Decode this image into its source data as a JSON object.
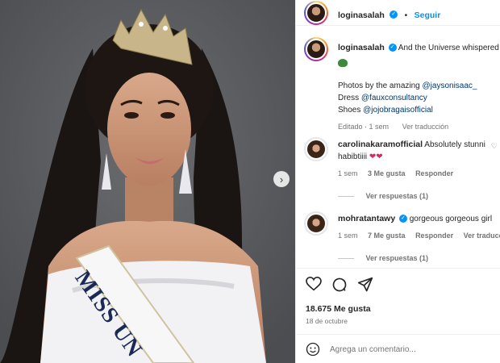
{
  "post": {
    "username": "loginasalah",
    "follow_label": "Seguir",
    "caption_preview": "And the Universe whispered",
    "credits_line": "Photos by the amazing",
    "photographer": "@jaysonisaac_",
    "dress_label": "Dress",
    "dress_credit": "@fauxconsultancy",
    "shoes_label": "Shoes",
    "shoes_credit": "@jojobragaisofficial",
    "edited_label": "Editado",
    "time": "1 sem",
    "see_translation": "Ver traducción",
    "likes": "18.675 Me gusta",
    "date": "18 de octubre",
    "sash_text": "MISS UN"
  },
  "comments": [
    {
      "username": "carolinakaramofficial",
      "text": "Absolutely stunni",
      "text2": "habibtiiii",
      "time": "1 sem",
      "likes": "3 Me gusta",
      "reply": "Responder",
      "view_replies": "Ver respuestas (1)"
    },
    {
      "username": "mohratantawy",
      "text": "gorgeous gorgeous girl",
      "time": "1 sem",
      "likes": "7 Me gusta",
      "reply": "Responder",
      "translation": "Ver traducción",
      "view_replies": "Ver respuestas (1)"
    }
  ],
  "composer": {
    "placeholder": "Agrega un comentario..."
  },
  "icons": {
    "like": "heart-icon",
    "comment": "comment-icon",
    "share": "share-icon",
    "emoji": "emoji-icon",
    "next": "chevron-right-icon"
  },
  "colors": {
    "link_blue": "#0095f6",
    "background_photo": "#5a5c5f",
    "sash_text": "#1b2a55"
  }
}
